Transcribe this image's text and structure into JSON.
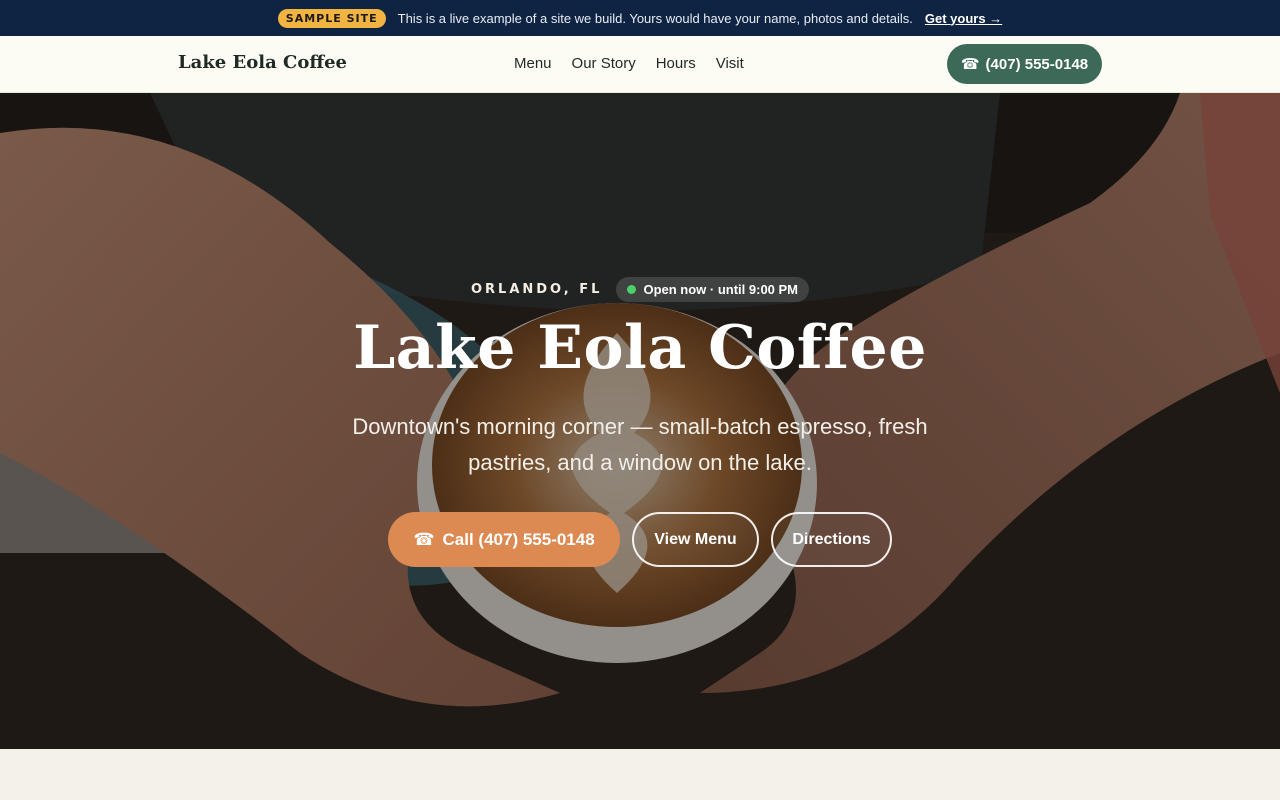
{
  "banner": {
    "badge": "SAMPLE SITE",
    "message": "This is a live example of a site we build. Yours would have your name, photos and details.",
    "cta": "Get yours →"
  },
  "nav": {
    "brand": "Lake Eola Coffee",
    "links": [
      "Menu",
      "Our Story",
      "Hours",
      "Visit"
    ],
    "phone_icon": "☎",
    "phone": "(407) 555-0148"
  },
  "hero": {
    "city": "ORLANDO, FL",
    "status": "Open now · until 9:00 PM",
    "title": "Lake Eola Coffee",
    "subtitle": "Downtown's morning corner — small-batch espresso, fresh pastries, and a window on the lake.",
    "call_icon": "☎",
    "call_label": "Call (407) 555-0148",
    "menu_label": "View Menu",
    "directions_label": "Directions"
  },
  "colors": {
    "banner_bg": "#0f2342",
    "badge_bg": "#f2b441",
    "nav_phone_bg": "#3d6a58",
    "primary_cta": "#dc8a52",
    "open_dot": "#4cd06a"
  }
}
